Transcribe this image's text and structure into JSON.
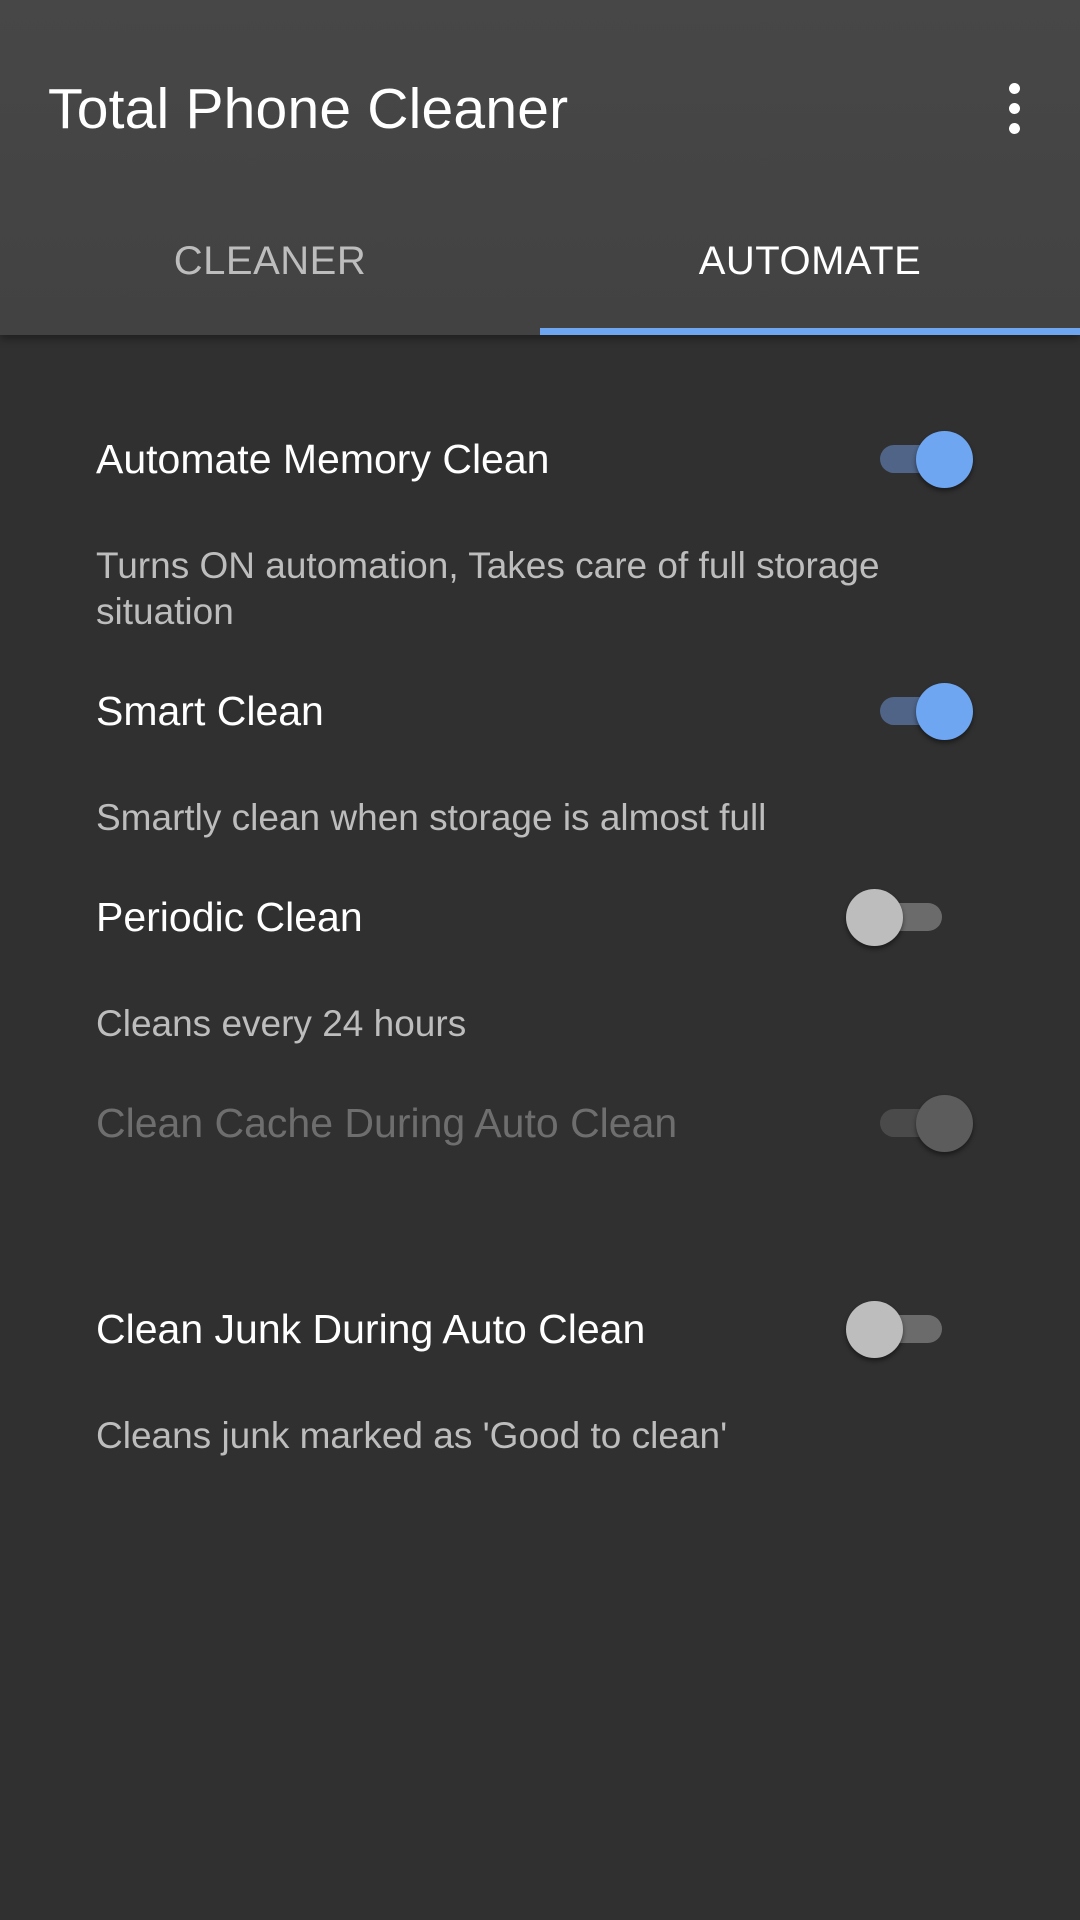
{
  "app": {
    "title": "Total Phone Cleaner",
    "overflow_icon": "more-vertical-icon"
  },
  "tabs": [
    {
      "label": "CLEANER",
      "selected": false
    },
    {
      "label": "AUTOMATE",
      "selected": true
    }
  ],
  "colors": {
    "accent": "#6ea6f2",
    "background": "#303030",
    "appbar": "#424242"
  },
  "settings": [
    {
      "title": "Automate Memory Clean",
      "summary": "Turns ON automation, Takes care of full storage situation",
      "checked": true,
      "enabled": true
    },
    {
      "title": "Smart Clean",
      "summary": "Smartly clean when storage is almost full",
      "checked": true,
      "enabled": true
    },
    {
      "title": "Periodic Clean",
      "summary": "Cleans every 24 hours",
      "checked": false,
      "enabled": true
    },
    {
      "title": "Clean Cache During Auto Clean",
      "summary": "",
      "checked": true,
      "enabled": false
    },
    {
      "title": "Clean Junk During Auto Clean",
      "summary": "Cleans junk marked as 'Good to clean'",
      "checked": false,
      "enabled": true
    }
  ]
}
